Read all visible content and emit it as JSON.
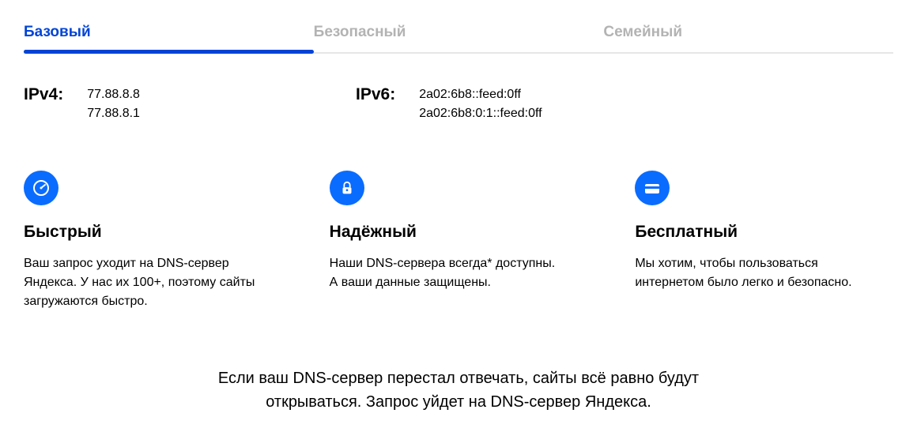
{
  "tabs": [
    {
      "label": "Базовый",
      "active": true
    },
    {
      "label": "Безопасный",
      "active": false
    },
    {
      "label": "Семейный",
      "active": false
    }
  ],
  "ipv4": {
    "label": "IPv4:",
    "addresses": [
      "77.88.8.8",
      "77.88.8.1"
    ]
  },
  "ipv6": {
    "label": "IPv6:",
    "addresses": [
      "2a02:6b8::feed:0ff",
      "2a02:6b8:0:1::feed:0ff"
    ]
  },
  "features": [
    {
      "title": "Быстрый",
      "desc": "Ваш запрос уходит на DNS-сервер Яндекса. У нас их 100+, поэтому сайты загружаются быстро."
    },
    {
      "title": "Надёжный",
      "desc": "Наши DNS-сервера всегда* доступны. А ваши данные защищены."
    },
    {
      "title": "Бесплатный",
      "desc": "Мы хотим, чтобы пользоваться интернетом было легко и безопасно."
    }
  ],
  "footnote": "Если ваш DNS-сервер перестал отвечать, сайты всё равно будут открываться. Запрос уйдет на DNS-сервер Яндекса."
}
